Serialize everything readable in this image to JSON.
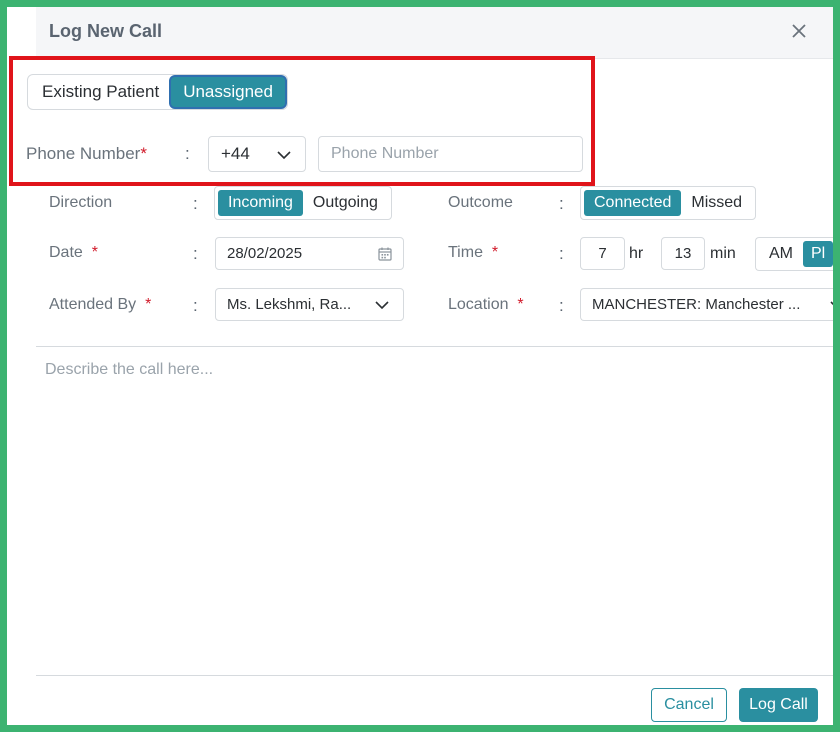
{
  "modal": {
    "title": "Log New Call",
    "close_icon": "close-icon"
  },
  "patient_toggle": {
    "options": [
      "Existing Patient",
      "Unassigned"
    ],
    "selected": "Unassigned"
  },
  "phone": {
    "label": "Phone Number",
    "required_mark": "*",
    "colon": ":",
    "country_code": "+44",
    "placeholder": "Phone Number",
    "value": ""
  },
  "direction": {
    "label": "Direction",
    "colon": ":",
    "options": [
      "Incoming",
      "Outgoing"
    ],
    "selected": "Incoming"
  },
  "outcome": {
    "label": "Outcome",
    "colon": ":",
    "options": [
      "Connected",
      "Missed"
    ],
    "selected": "Connected"
  },
  "date": {
    "label": "Date",
    "required_mark": "*",
    "colon": ":",
    "value": "28/02/2025",
    "icon": "calendar-icon"
  },
  "time": {
    "label": "Time",
    "required_mark": "*",
    "colon": ":",
    "hour": "7",
    "hour_unit": "hr",
    "minute": "13",
    "minute_unit": "min",
    "ampm_options": [
      "AM",
      "PM"
    ],
    "ampm_selected": "PM",
    "ampm_visible": "Pl"
  },
  "attended_by": {
    "label": "Attended By",
    "required_mark": "*",
    "colon": ":",
    "value": "Ms. Lekshmi, Ra..."
  },
  "location": {
    "label": "Location",
    "required_mark": "*",
    "colon": ":",
    "value": "MANCHESTER: Manchester ..."
  },
  "description": {
    "placeholder": "Describe the call here..."
  },
  "footer": {
    "cancel_label": "Cancel",
    "submit_label": "Log Call"
  },
  "colors": {
    "accent": "#2a8fa0",
    "highlight": "#e0141a",
    "frame": "#3cb371",
    "required": "#d11a2a"
  }
}
